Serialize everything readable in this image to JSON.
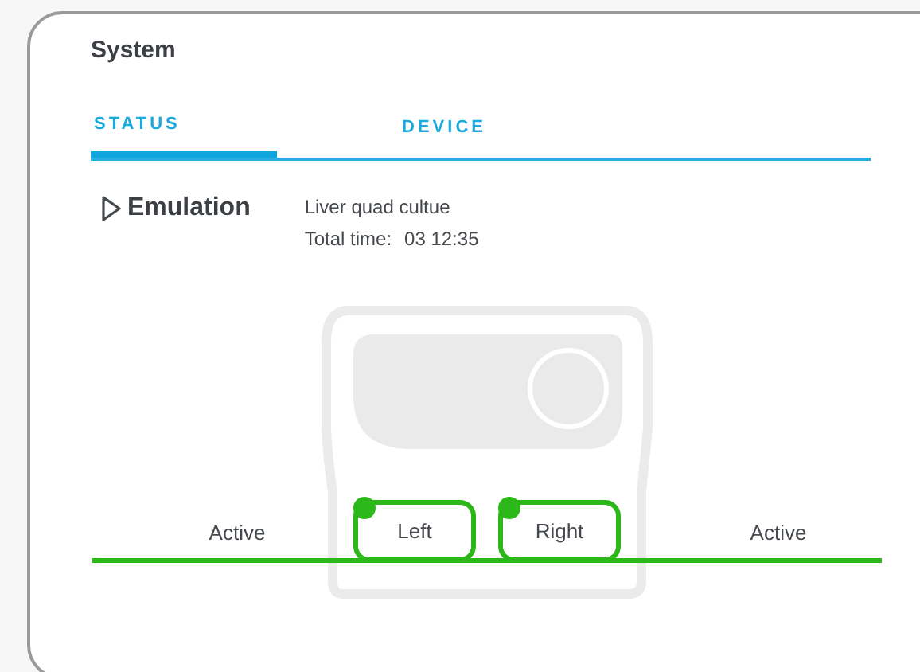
{
  "title": "System",
  "tabs": [
    {
      "label": "STATUS",
      "selected": true
    },
    {
      "label": "DEVICE",
      "selected": false
    }
  ],
  "emulation": {
    "label": "Emulation",
    "culture": "Liver quad cultue",
    "total_time_label": "Total time:",
    "total_time": "03 12:35"
  },
  "channels": [
    {
      "status": "Active",
      "port": "Left",
      "active": true
    },
    {
      "status": "Active",
      "port": "Right",
      "active": true
    }
  ]
}
